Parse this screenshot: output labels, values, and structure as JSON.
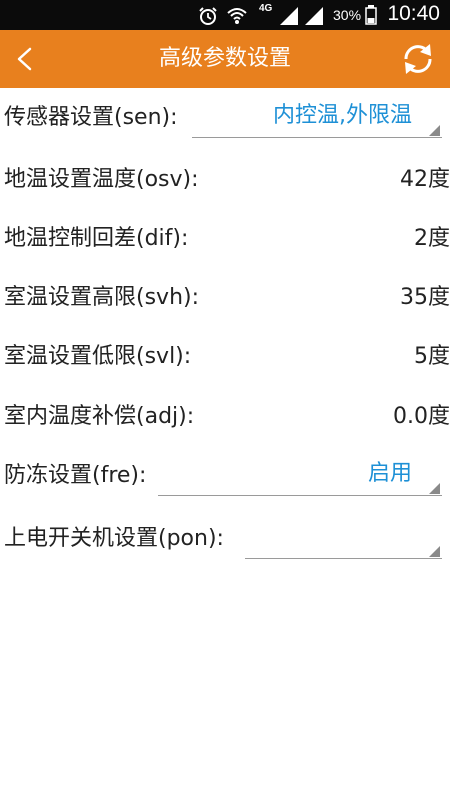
{
  "status_bar": {
    "network": "4G",
    "battery": "30%",
    "time": "10:40"
  },
  "app_bar": {
    "title": "高级参数设置"
  },
  "settings": [
    {
      "label": "传感器设置(sen):",
      "value": "内控温,外限温"
    },
    {
      "label": "地温设置温度(osv):",
      "value": "42度 "
    },
    {
      "label": "地温控制回差(dif):",
      "value": "2度 "
    },
    {
      "label": "室温设置高限(svh):",
      "value": "35度 "
    },
    {
      "label": "室温设置低限(svl):",
      "value": "5度 "
    },
    {
      "label": "室内温度补偿(adj):",
      "value": "0.0度 "
    },
    {
      "label": "防冻设置(fre):",
      "value": "启用"
    },
    {
      "label": "上电开关机设置(pon):",
      "value": ""
    }
  ],
  "colors": {
    "accent": "#e8801e",
    "link": "#1e90d6",
    "status_bar": "#0b0b0b"
  },
  "icons": {
    "back": "chevron-left",
    "refresh": "refresh"
  }
}
